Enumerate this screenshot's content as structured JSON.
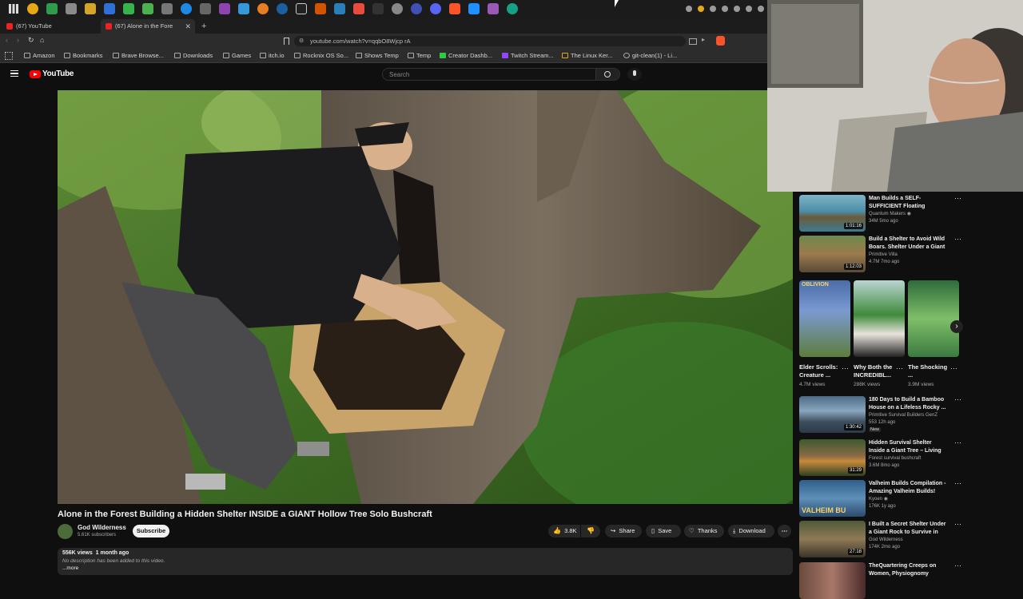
{
  "browser": {
    "tabs": [
      {
        "label": "(67) YouTube"
      },
      {
        "label": "(67) Alone in the Fore"
      }
    ],
    "url": "youtube.com/watch?v=qqbO8Wjcp rA",
    "bookmarks": [
      "Amazon",
      "Bookmarks",
      "Brave Browse...",
      "Downloads",
      "Games",
      "itch.io",
      "Rocknix OS So...",
      "Shows Temp",
      "Temp",
      "Creator Dashb...",
      "Twitch Stream...",
      "The Linux Ker...",
      "git-clean(1) - Li..."
    ]
  },
  "youtube": {
    "logo_text": "YouTube",
    "search_placeholder": "Search"
  },
  "video": {
    "title": "Alone in the Forest Building a Hidden Shelter INSIDE a GIANT Hollow Tree Solo Bushcraft",
    "channel": "God Wilderness",
    "subscribers": "5.61K subscribers",
    "subscribe_label": "Subscribe",
    "likes": "3.8K",
    "share_label": "Share",
    "save_label": "Save",
    "thanks_label": "Thanks",
    "download_label": "Download",
    "views_date": "556K views  1 month ago",
    "description": "No description has been added to this video.",
    "more_label": "...more"
  },
  "recommendations_top": [
    {
      "title": "Man Builds a SELF-SUFFICIENT Floating Bamboo Island (Solo)...",
      "channel": "Quantum Makers",
      "meta": "34M  5mo ago",
      "duration": "1:01:16"
    },
    {
      "title": "Build a Shelter to Avoid Wild Boars. Shelter Under a Giant ...",
      "channel": "Primitive Villa",
      "meta": "4.7M  7mo ago",
      "duration": "1:12:03"
    }
  ],
  "shorts": [
    {
      "title": "Elder Scrolls: Creature ...",
      "views": "4.7M views",
      "label": "OBLIVION"
    },
    {
      "title": "Why Both the INCREDIBL...",
      "views": "288K views"
    },
    {
      "title": "The Shocking ...",
      "views": "3.9M views"
    }
  ],
  "recommendations_bottom": [
    {
      "title": "180 Days to Build a Bamboo House on a Lifeless Rocky ...",
      "channel": "Primitive Survival Builders GenZ",
      "meta": "553  12h ago",
      "badge": "New",
      "duration": "1:30:42"
    },
    {
      "title": "Hidden Survival Shelter Inside a Giant Tree – Living in the ...",
      "channel": "Forest survival bushcraft",
      "meta": "3.6M  8mo ago",
      "duration": "31:29"
    },
    {
      "title": "Valheim Builds Compilation - Amazing Valheim Builds!",
      "channel": "Kyoen",
      "meta": "176K  1y ago",
      "duration": "",
      "thumb_text": "VALHEIM BU"
    },
    {
      "title": "I Built a Secret Shelter Under a Giant Rock to Survive in the ...",
      "channel": "God Wilderness",
      "meta": "174K  2mo ago",
      "duration": "27:18"
    },
    {
      "title": "TheQuartering Creeps on Women, Physiognomy Check!",
      "channel": "",
      "meta": "",
      "duration": ""
    }
  ],
  "colors": {
    "bg": "#0f0f0f",
    "brand_red": "#ff0000",
    "text_secondary": "#aaaaaa"
  }
}
